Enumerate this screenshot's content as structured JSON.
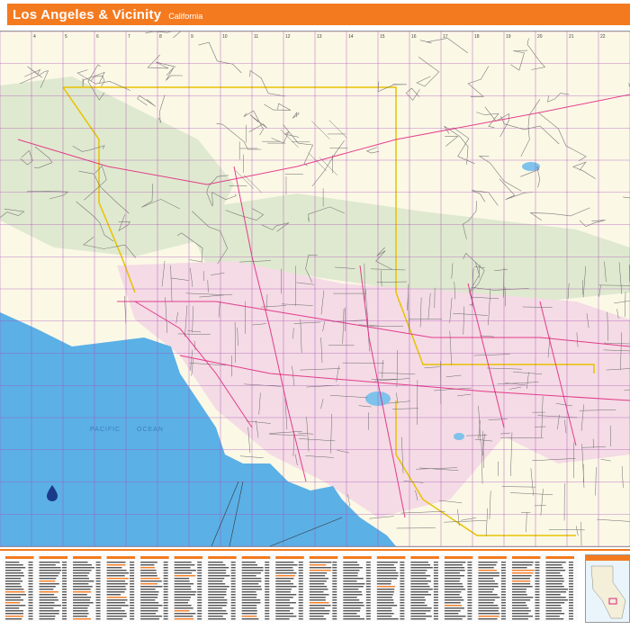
{
  "header": {
    "title": "Los Angeles & Vicinity",
    "subtitle": "California"
  },
  "map": {
    "ocean_label_1": "PACIFIC",
    "ocean_label_2": "OCEAN",
    "grid_columns": [
      "4",
      "5",
      "6",
      "7",
      "8",
      "9",
      "10",
      "11",
      "12",
      "13",
      "14",
      "15",
      "16",
      "17",
      "18",
      "19",
      "20",
      "21",
      "22"
    ],
    "colors": {
      "header": "#f47a20",
      "ocean": "#5bb0e6",
      "land": "#fbf8e6",
      "hills": "#dfe9cf",
      "urban": "#f4d7e2",
      "roads": "#6a6a6a",
      "highways": "#e0207a",
      "boundary": "#e8c200",
      "grid": "#a94bb8"
    }
  },
  "index": {
    "description": "street index columns"
  }
}
